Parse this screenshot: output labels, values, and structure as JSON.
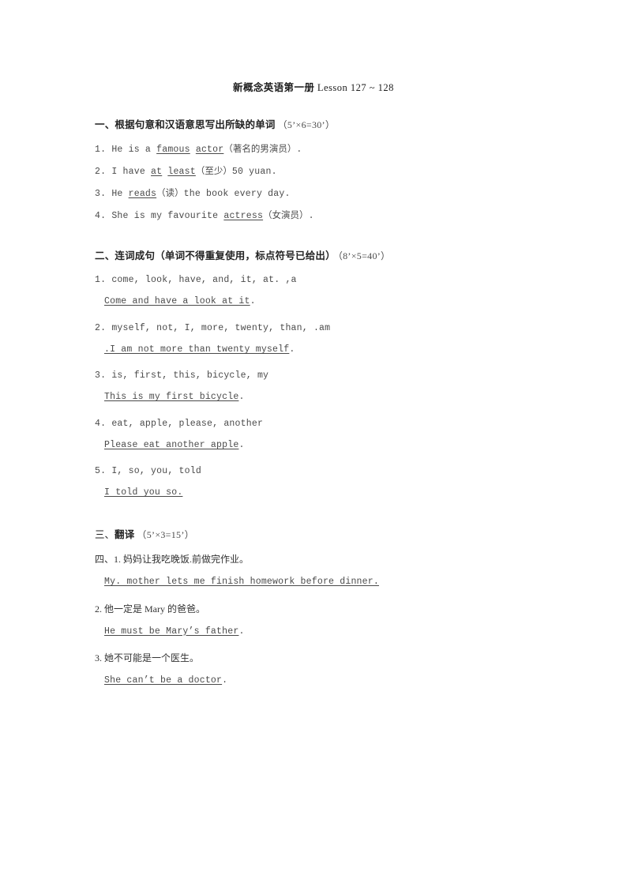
{
  "document": {
    "title_cn": "新概念英语第一册",
    "title_en": "Lesson 127 ~ 128"
  },
  "sections": [
    {
      "id": "section-one",
      "number": "一、",
      "heading_cn": "根据句意和汉语意思写出所缺的单词",
      "score": "（5’×6=30’）",
      "items": [
        {
          "number": "1.",
          "pre": "He is a ",
          "blank1": "famous",
          "mid": " ",
          "blank2": "actor",
          "post_cn": "（著名的男演员）",
          "post": "."
        },
        {
          "number": "2.",
          "pre": "I have ",
          "blank1": "at",
          "mid": " ",
          "blank2": "least",
          "post_cn": "（至少）",
          "post": "50 yuan."
        },
        {
          "number": "3.",
          "pre": "He ",
          "blank1": "reads",
          "mid": "",
          "blank2": "",
          "post_cn": "（读）",
          "post": "the book every day."
        },
        {
          "number": "4.",
          "pre": "She is my favourite ",
          "blank1": "actress",
          "mid": "",
          "blank2": "",
          "post_cn": "（女演员）",
          "post": "."
        }
      ]
    },
    {
      "id": "section-two",
      "number": "二、",
      "heading_cn": "连词成句（单词不得重复使用，标点符号已给出）",
      "score": "（8’×5=40’）",
      "items": [
        {
          "number": "1.",
          "words": "come, look, have, and, it, at. ,a",
          "answer_pre": "",
          "answer_underlined": "Come and have a look at it",
          "answer_post": "."
        },
        {
          "number": "2.",
          "words": "myself, not, I, more, twenty, than, .am",
          "answer_pre": "",
          "answer_underlined": ".I am not more than twenty myself",
          "answer_post": "."
        },
        {
          "number": "3.",
          "words": "is, first, this, bicycle, my",
          "answer_pre": "",
          "answer_underlined": "This is my first bicycle",
          "answer_post": "."
        },
        {
          "number": "4.",
          "words": "eat, apple, please, another",
          "answer_pre": "",
          "answer_underlined": "Please eat another apple",
          "answer_post": "."
        },
        {
          "number": "5.",
          "words": "I, so, you, told",
          "answer_pre": "",
          "answer_underlined": "I told you so.",
          "answer_post": ""
        }
      ]
    },
    {
      "id": "section-three",
      "number": "三、",
      "heading_cn": "翻译",
      "score": "（5’×3=15’）",
      "items": [
        {
          "number": "四、1.",
          "prompt_cn": "妈妈让我吃晚饭.前做完作业。",
          "answer_underlined": "My. mother lets me finish homework before dinner.",
          "answer_post": ""
        },
        {
          "number": "2.",
          "prompt_cn": "他一定是 Mary 的爸爸。",
          "answer_underlined": "He must be Mary’s father",
          "answer_post": "."
        },
        {
          "number": "3.",
          "prompt_cn": "她不可能是一个医生。",
          "answer_underlined": "She can’t be a doctor",
          "answer_post": "."
        }
      ]
    }
  ]
}
